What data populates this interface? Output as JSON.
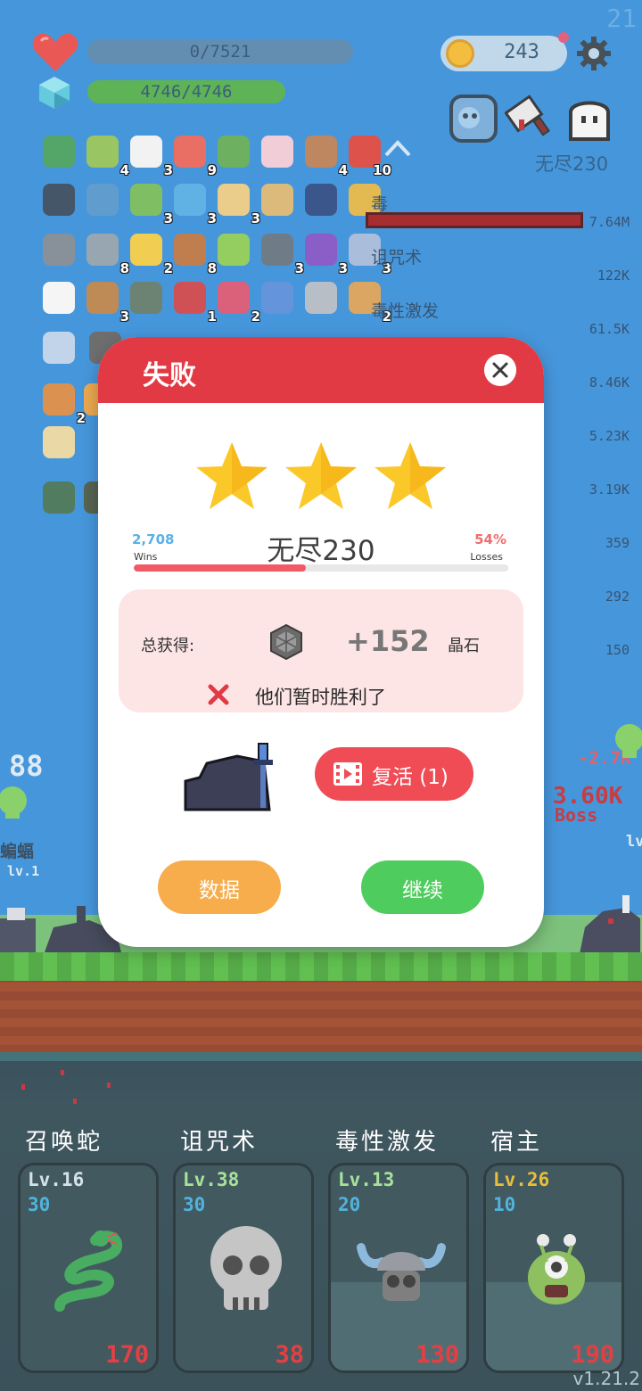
{
  "hud": {
    "fps": "21",
    "hp_text": "0/7521",
    "mp_text": "4746/4746",
    "coins": "243",
    "boss_label": "无尽230",
    "version": "v1.21.2"
  },
  "inventory": [
    {
      "icon": "witch-hat-icon",
      "count": ""
    },
    {
      "icon": "potion-flask-icon",
      "count": "4"
    },
    {
      "icon": "flower-icon",
      "count": "3"
    },
    {
      "icon": "watermelon-icon",
      "count": "9"
    },
    {
      "icon": "green-book-icon",
      "count": ""
    },
    {
      "icon": "ice-cream-icon",
      "count": ""
    },
    {
      "icon": "donut-icon",
      "count": "4"
    },
    {
      "icon": "apple-icon",
      "count": "10"
    },
    {
      "icon": "sickle-icon",
      "count": ""
    },
    {
      "icon": "magnifier-icon",
      "count": ""
    },
    {
      "icon": "green-potion-icon",
      "count": "3"
    },
    {
      "icon": "speech-bubble-icon",
      "count": "3"
    },
    {
      "icon": "scroll-icon",
      "count": "3"
    },
    {
      "icon": "hooded-figure-icon",
      "count": ""
    },
    {
      "icon": "lion-shield-icon",
      "count": ""
    },
    {
      "icon": "beer-icon",
      "count": "3"
    },
    {
      "icon": "compass-icon",
      "count": ""
    },
    {
      "icon": "sword-icon",
      "count": "8"
    },
    {
      "icon": "sunflower-icon",
      "count": "2"
    },
    {
      "icon": "spellbook-icon",
      "count": "8"
    },
    {
      "icon": "lime-icon",
      "count": ""
    },
    {
      "icon": "dagger-icon",
      "count": "3"
    },
    {
      "icon": "crystal-ball-icon",
      "count": "3"
    },
    {
      "icon": "pill-icon",
      "count": "3"
    },
    {
      "icon": "cards-icon",
      "count": ""
    },
    {
      "icon": "crossbow-icon",
      "count": "3"
    },
    {
      "icon": "zombie-face-icon",
      "count": ""
    },
    {
      "icon": "capsule-icon",
      "count": "1"
    },
    {
      "icon": "red-flask-icon",
      "count": "2"
    },
    {
      "icon": "star-card-icon",
      "count": ""
    },
    {
      "icon": "angel-icon",
      "count": ""
    },
    {
      "icon": "parchment-icon",
      "count": "2"
    },
    {
      "icon": "molecule-icon",
      "count": ""
    },
    {
      "icon": "mortar-icon",
      "count": ""
    },
    {
      "icon": "briefcase-icon",
      "count": "2"
    },
    {
      "icon": "cutlery-icon",
      "count": ""
    },
    {
      "icon": "map-icon",
      "count": ""
    },
    {
      "icon": "pixel-tile-icon",
      "count": ""
    },
    {
      "icon": "pixel-chest-icon",
      "count": ""
    }
  ],
  "damage_stats": [
    {
      "name": "毒",
      "value": "7.64M",
      "fill": 1.0
    },
    {
      "name": "诅咒术",
      "value": "122K",
      "fill": 0.0
    },
    {
      "name": "毒性激发",
      "value": "61.5K",
      "fill": 0.0
    },
    {
      "name": "",
      "value": "8.46K",
      "fill": 0.0
    },
    {
      "name": "",
      "value": "5.23K",
      "fill": 0.0
    },
    {
      "name": "",
      "value": "3.19K",
      "fill": 0.0
    },
    {
      "name": "",
      "value": "359",
      "fill": 0.0
    },
    {
      "name": "",
      "value": "292",
      "fill": 0.0
    },
    {
      "name": "",
      "value": "150",
      "fill": 0.0
    }
  ],
  "scene": {
    "left_enemy_name": "蝙蝠",
    "left_enemy_level": "lv.1",
    "right_enemy_level": "lv",
    "float_numbers": [
      "88",
      "-2.7K",
      "3.60K",
      "Boss"
    ]
  },
  "modal": {
    "title": "失败",
    "stars": 3,
    "wins": "2,708",
    "wins_label": "Wins",
    "losses": "54%",
    "losses_label": "Losses",
    "stage": "无尽230",
    "win_ratio": 0.46,
    "reward_label": "总获得:",
    "reward_amount": "+152",
    "reward_unit": "晶石",
    "result_text": "他们暂时胜利了",
    "revive_label": "复活 (1)",
    "data_button": "数据",
    "continue_button": "继续"
  },
  "skills": [
    {
      "name": "召唤蛇",
      "level": "Lv.16",
      "cost": "30",
      "damage": "170",
      "icon": "snake-icon",
      "level_color": "#cfe0e6"
    },
    {
      "name": "诅咒术",
      "level": "Lv.38",
      "cost": "30",
      "damage": "38",
      "icon": "skull-icon",
      "level_color": "#9be08a"
    },
    {
      "name": "毒性激发",
      "level": "Lv.13",
      "cost": "20",
      "damage": "130",
      "icon": "viking-skull-icon",
      "level_color": "#9be08a"
    },
    {
      "name": "宿主",
      "level": "Lv.26",
      "cost": "10",
      "damage": "190",
      "icon": "green-monster-icon",
      "level_color": "#e7b51e"
    }
  ],
  "colors": {
    "modal_header": "#e23a44",
    "wins": "#58b1e6",
    "losses": "#ef6e6e",
    "data_button": "#f8ad4c",
    "continue_button": "#4fcc5e",
    "revive_button": "#ef4c55"
  }
}
